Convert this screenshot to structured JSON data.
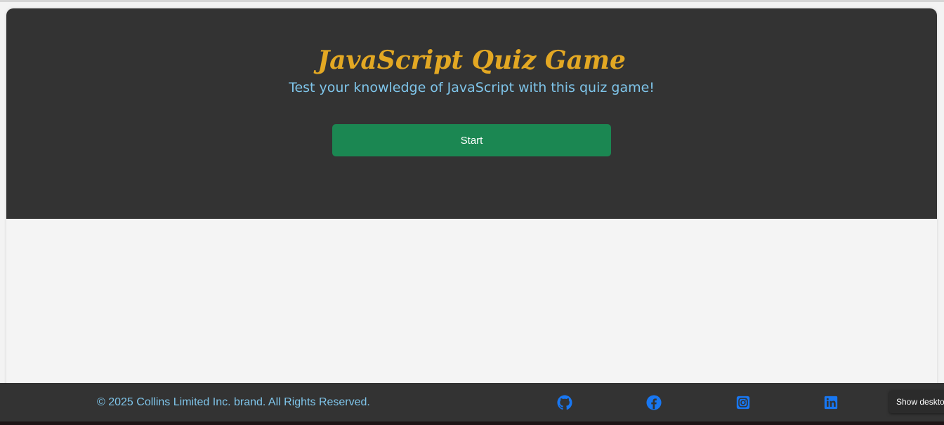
{
  "hero": {
    "title": "JavaScript Quiz Game",
    "subtitle": "Test your knowledge of JavaScript with this quiz game!",
    "start_label": "Start"
  },
  "footer": {
    "copyright": "© 2025 Collins Limited Inc. brand. All Rights Reserved.",
    "social_icons": [
      "github-icon",
      "facebook-icon",
      "instagram-icon",
      "linkedin-icon"
    ]
  },
  "tooltip": {
    "text": "Show deskto"
  },
  "colors": {
    "hero_background": "#333333",
    "title": "#e3a823",
    "subtitle": "#7fc5ea",
    "start_button": "#1b8752",
    "social_icon": "#1877f2",
    "page_background": "#f3f3f3"
  }
}
